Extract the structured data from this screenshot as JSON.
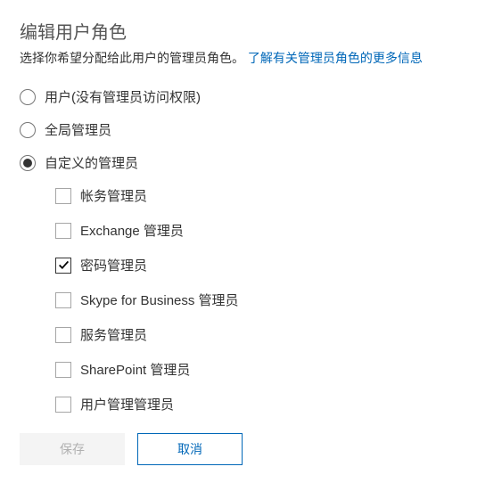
{
  "header": {
    "title": "编辑用户角色",
    "subtitle_prefix": "选择你希望分配给此用户的管理员角色。",
    "subtitle_link": "了解有关管理员角色的更多信息"
  },
  "roles": {
    "options": [
      {
        "id": "user",
        "label": "用户(没有管理员访问权限)",
        "selected": false
      },
      {
        "id": "global",
        "label": "全局管理员",
        "selected": false
      },
      {
        "id": "custom",
        "label": "自定义的管理员",
        "selected": true
      }
    ]
  },
  "custom_admins": {
    "items": [
      {
        "id": "billing",
        "label": "帐务管理员",
        "checked": false
      },
      {
        "id": "exchange",
        "label": "Exchange 管理员",
        "checked": false
      },
      {
        "id": "password",
        "label": "密码管理员",
        "checked": true
      },
      {
        "id": "skype",
        "label": "Skype for Business 管理员",
        "checked": false
      },
      {
        "id": "service",
        "label": "服务管理员",
        "checked": false
      },
      {
        "id": "sharepoint",
        "label": "SharePoint 管理员",
        "checked": false
      },
      {
        "id": "usermgmt",
        "label": "用户管理管理员",
        "checked": false
      }
    ]
  },
  "buttons": {
    "save": "保存",
    "cancel": "取消"
  }
}
